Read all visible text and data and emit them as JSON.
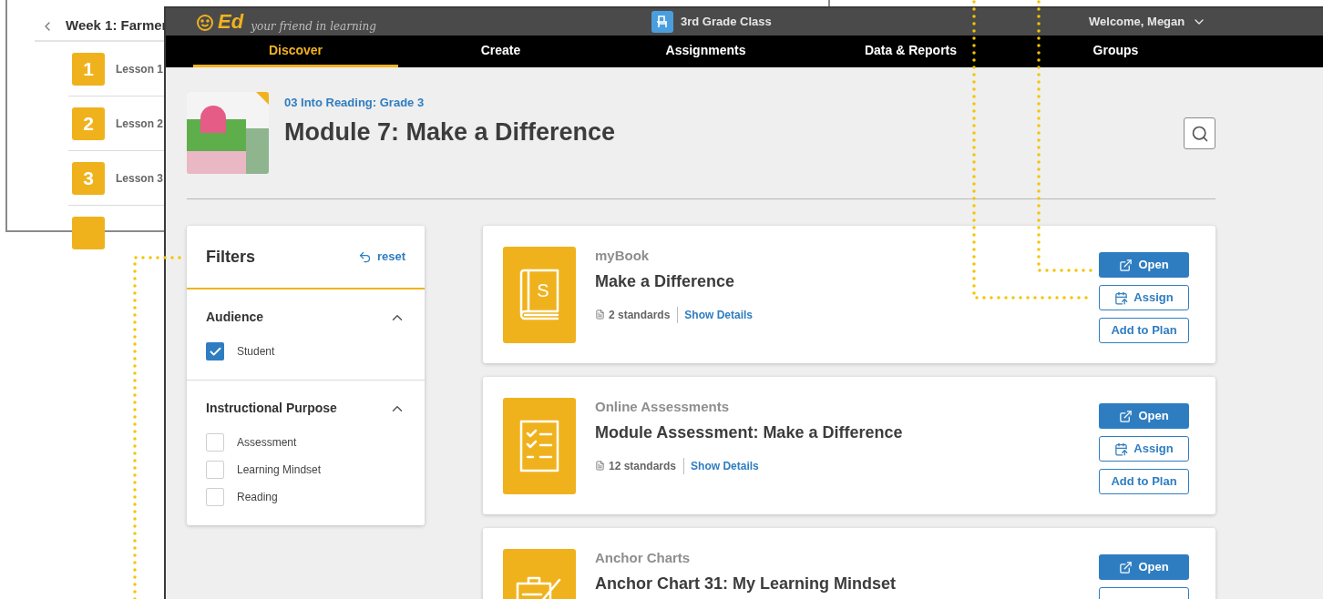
{
  "background_panel": {
    "title": "Week 1: Farmer",
    "lessons": [
      {
        "number": "1",
        "label": "Lesson 1"
      },
      {
        "number": "2",
        "label": "Lesson 2"
      },
      {
        "number": "3",
        "label": "Lesson 3"
      }
    ]
  },
  "header": {
    "logo": "Ed",
    "tagline": "your friend in learning",
    "class_name": "3rd Grade Class",
    "welcome": "Welcome, Megan"
  },
  "tabs": [
    {
      "label": "Discover",
      "selected": true
    },
    {
      "label": "Create",
      "selected": false
    },
    {
      "label": "Assignments",
      "selected": false
    },
    {
      "label": "Data & Reports",
      "selected": false
    },
    {
      "label": "Groups",
      "selected": false
    }
  ],
  "module": {
    "breadcrumb": "03 Into Reading: Grade 3",
    "title": "Module 7: Make a Difference"
  },
  "filters": {
    "title": "Filters",
    "reset": "reset",
    "sections": [
      {
        "title": "Audience",
        "expanded": true,
        "options": [
          {
            "label": "Student",
            "checked": true
          }
        ]
      },
      {
        "title": "Instructional Purpose",
        "expanded": true,
        "options": [
          {
            "label": "Assessment",
            "checked": false
          },
          {
            "label": "Learning Mindset",
            "checked": false
          },
          {
            "label": "Reading",
            "checked": false
          }
        ]
      }
    ]
  },
  "resources": [
    {
      "kind": "book",
      "icon_letter": "S",
      "category": "myBook",
      "title": "Make a Difference",
      "standards": "2 standards",
      "details_link": "Show Details",
      "buttons": [
        "Open",
        "Assign",
        "Add to Plan"
      ]
    },
    {
      "kind": "checklist",
      "category": "Online Assessments",
      "title": "Module Assessment: Make a Difference",
      "standards": "12 standards",
      "details_link": "Show Details",
      "buttons": [
        "Open",
        "Assign",
        "Add to Plan"
      ]
    },
    {
      "kind": "clipboard",
      "category": "Anchor Charts",
      "title": "Anchor Chart 31: My Learning Mindset",
      "buttons": [
        "Open"
      ],
      "cut_button": true
    }
  ]
}
